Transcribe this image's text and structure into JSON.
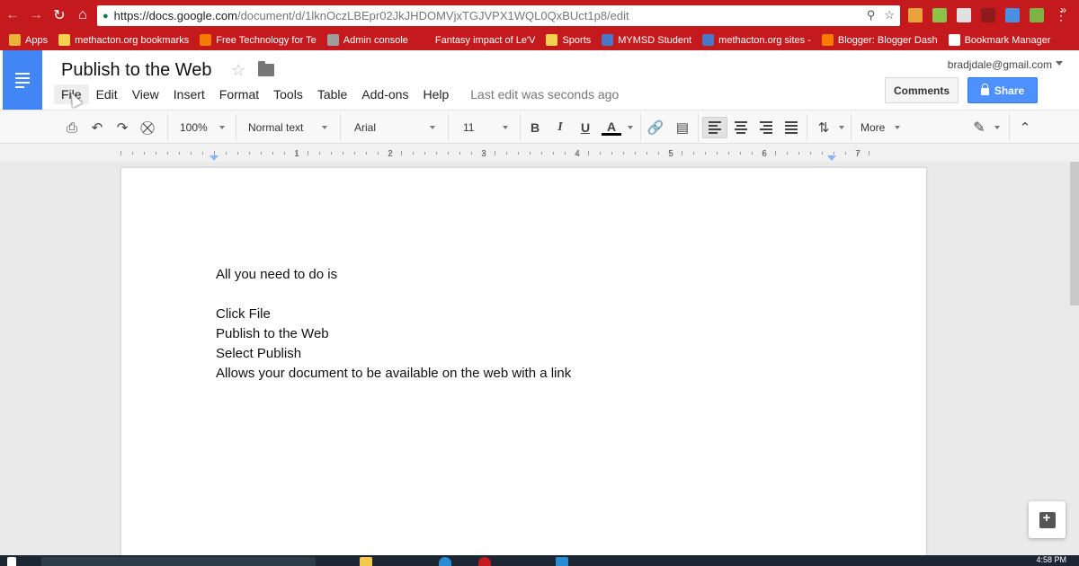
{
  "browser": {
    "url_host": "https://docs.google.com",
    "url_path": "/document/d/1lknOczLBEpr02JkJHDOMVjxTGJVPX1WQL0QxBUct1p8/edit",
    "bookmarks": [
      {
        "label": "Apps",
        "color": "#e9b23a"
      },
      {
        "label": "methacton.org bookmarks",
        "color": "#f2d24e"
      },
      {
        "label": "Free Technology for Te",
        "color": "#f57c00"
      },
      {
        "label": "Admin console",
        "color": "#9e9e9e"
      },
      {
        "label": "Fantasy impact of Le'V",
        "color": "#c41a1e"
      },
      {
        "label": "Sports",
        "color": "#f2d24e"
      },
      {
        "label": "MYMSD Student",
        "color": "#4a78c8"
      },
      {
        "label": "methacton.org sites -",
        "color": "#4a78c8"
      },
      {
        "label": "Blogger: Blogger Dash",
        "color": "#f57c00"
      },
      {
        "label": "Bookmark Manager",
        "color": "#ffffff"
      }
    ],
    "more": "»"
  },
  "docs": {
    "title": "Publish to the Web",
    "menu": [
      "File",
      "Edit",
      "View",
      "Insert",
      "Format",
      "Tools",
      "Table",
      "Add-ons",
      "Help"
    ],
    "last_edit": "Last edit was seconds ago",
    "account": "bradjdale@gmail.com",
    "comments_label": "Comments",
    "share_label": "Share"
  },
  "toolbar": {
    "zoom": "100%",
    "style": "Normal text",
    "font": "Arial",
    "size": "11",
    "more": "More"
  },
  "ruler": [
    "1",
    "2",
    "3",
    "4",
    "5",
    "6",
    "7"
  ],
  "document": {
    "lines": [
      "All you need to do is",
      "",
      "Click File",
      "Publish to the Web",
      "Select Publish",
      "Allows your document to be available on the web with a link"
    ]
  },
  "taskbar": {
    "clock": "4:58 PM"
  }
}
